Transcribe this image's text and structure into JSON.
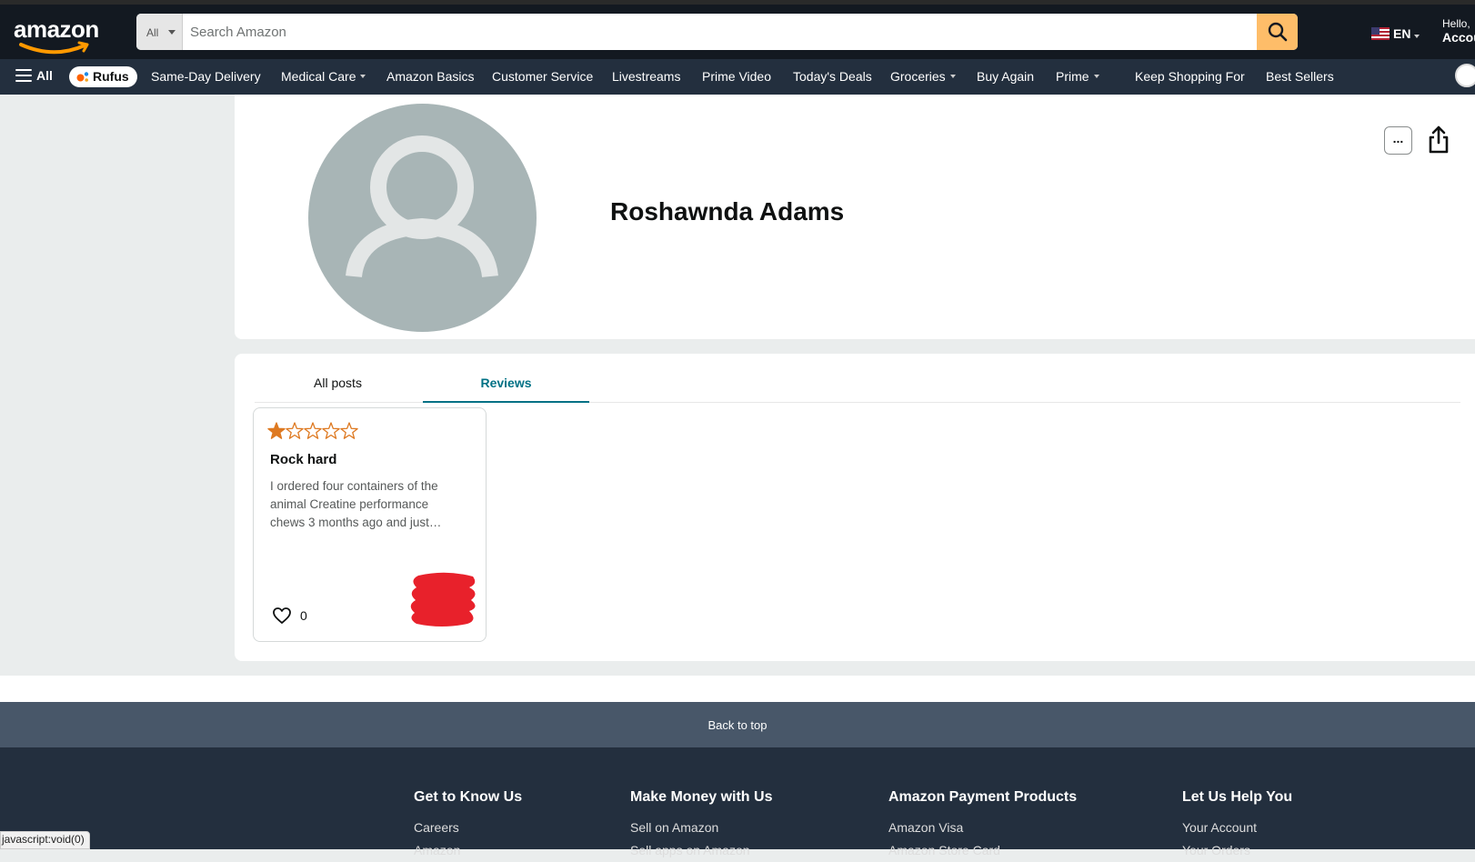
{
  "header": {
    "logo_text": "amazon",
    "search": {
      "category": "All",
      "placeholder": "Search Amazon"
    },
    "language": "EN",
    "account": {
      "greeting": "Hello,",
      "label": "Accou"
    }
  },
  "nav": {
    "all_label": "All",
    "rufus_label": "Rufus",
    "items": [
      {
        "label": "Same-Day Delivery"
      },
      {
        "label": "Medical Care"
      },
      {
        "label": "Amazon Basics"
      },
      {
        "label": "Customer Service"
      },
      {
        "label": "Livestreams"
      },
      {
        "label": "Prime Video"
      },
      {
        "label": "Today's Deals"
      },
      {
        "label": "Groceries"
      },
      {
        "label": "Buy Again"
      },
      {
        "label": "Prime"
      },
      {
        "label": "Keep Shopping For"
      },
      {
        "label": "Best Sellers"
      }
    ]
  },
  "profile": {
    "name": "Roshawnda Adams",
    "more_label": "..."
  },
  "tabs": [
    {
      "label": "All posts"
    },
    {
      "label": "Reviews"
    }
  ],
  "review": {
    "rating": 1,
    "max_rating": 5,
    "title": "Rock hard",
    "body": "I ordered four containers of the animal Creatine performance chews 3 months ago and just…",
    "likes": "0"
  },
  "footer": {
    "back_to_top": "Back to top",
    "columns": [
      {
        "heading": "Get to Know Us",
        "links": [
          "Careers",
          "Amazon"
        ]
      },
      {
        "heading": "Make Money with Us",
        "links": [
          "Sell on Amazon",
          "Sell apps on Amazon"
        ]
      },
      {
        "heading": "Amazon Payment Products",
        "links": [
          "Amazon Visa",
          "Amazon Store Card"
        ]
      },
      {
        "heading": "Let Us Help You",
        "links": [
          "Your Account",
          "Your Orders"
        ]
      }
    ]
  },
  "status_bar": "javascript:void(0)",
  "colors": {
    "header_bg": "#131921",
    "nav_bg": "#232f3e",
    "search_button": "#febd69",
    "accent_teal": "#007185",
    "star": "#de7921",
    "back_to_top_bg": "#485769"
  }
}
